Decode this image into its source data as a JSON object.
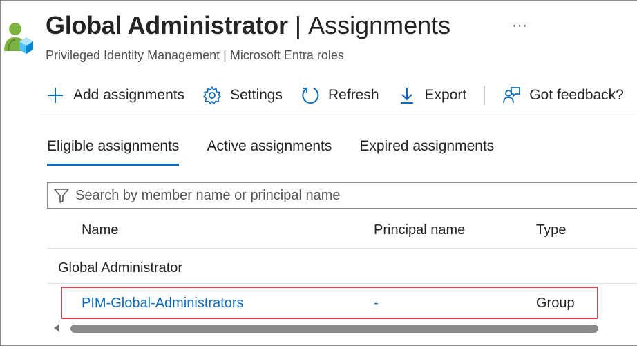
{
  "header": {
    "title_main": "Global Administrator",
    "title_separator": "|",
    "title_sub": "Assignments",
    "subtitle": "Privileged Identity Management | Microsoft Entra roles",
    "more_label": "···"
  },
  "toolbar": {
    "add_label": "Add assignments",
    "settings_label": "Settings",
    "refresh_label": "Refresh",
    "export_label": "Export",
    "feedback_label": "Got feedback?"
  },
  "tabs": [
    {
      "label": "Eligible assignments",
      "active": true
    },
    {
      "label": "Active assignments",
      "active": false
    },
    {
      "label": "Expired assignments",
      "active": false
    }
  ],
  "search": {
    "placeholder": "Search by member name or principal name",
    "value": ""
  },
  "table": {
    "columns": [
      "Name",
      "Principal name",
      "Type"
    ],
    "groups": [
      {
        "label": "Global Administrator",
        "rows": [
          {
            "name": "PIM-Global-Administrators",
            "principal": "-",
            "type": "Group"
          }
        ]
      }
    ]
  },
  "colors": {
    "accent": "#0f6cbd",
    "highlight": "#e0404a",
    "text": "#242424"
  },
  "icons": {
    "role": "role-user-icon",
    "add": "plus-icon",
    "settings": "gear-icon",
    "refresh": "refresh-icon",
    "export": "download-icon",
    "feedback": "feedback-icon",
    "search": "filter-icon"
  }
}
